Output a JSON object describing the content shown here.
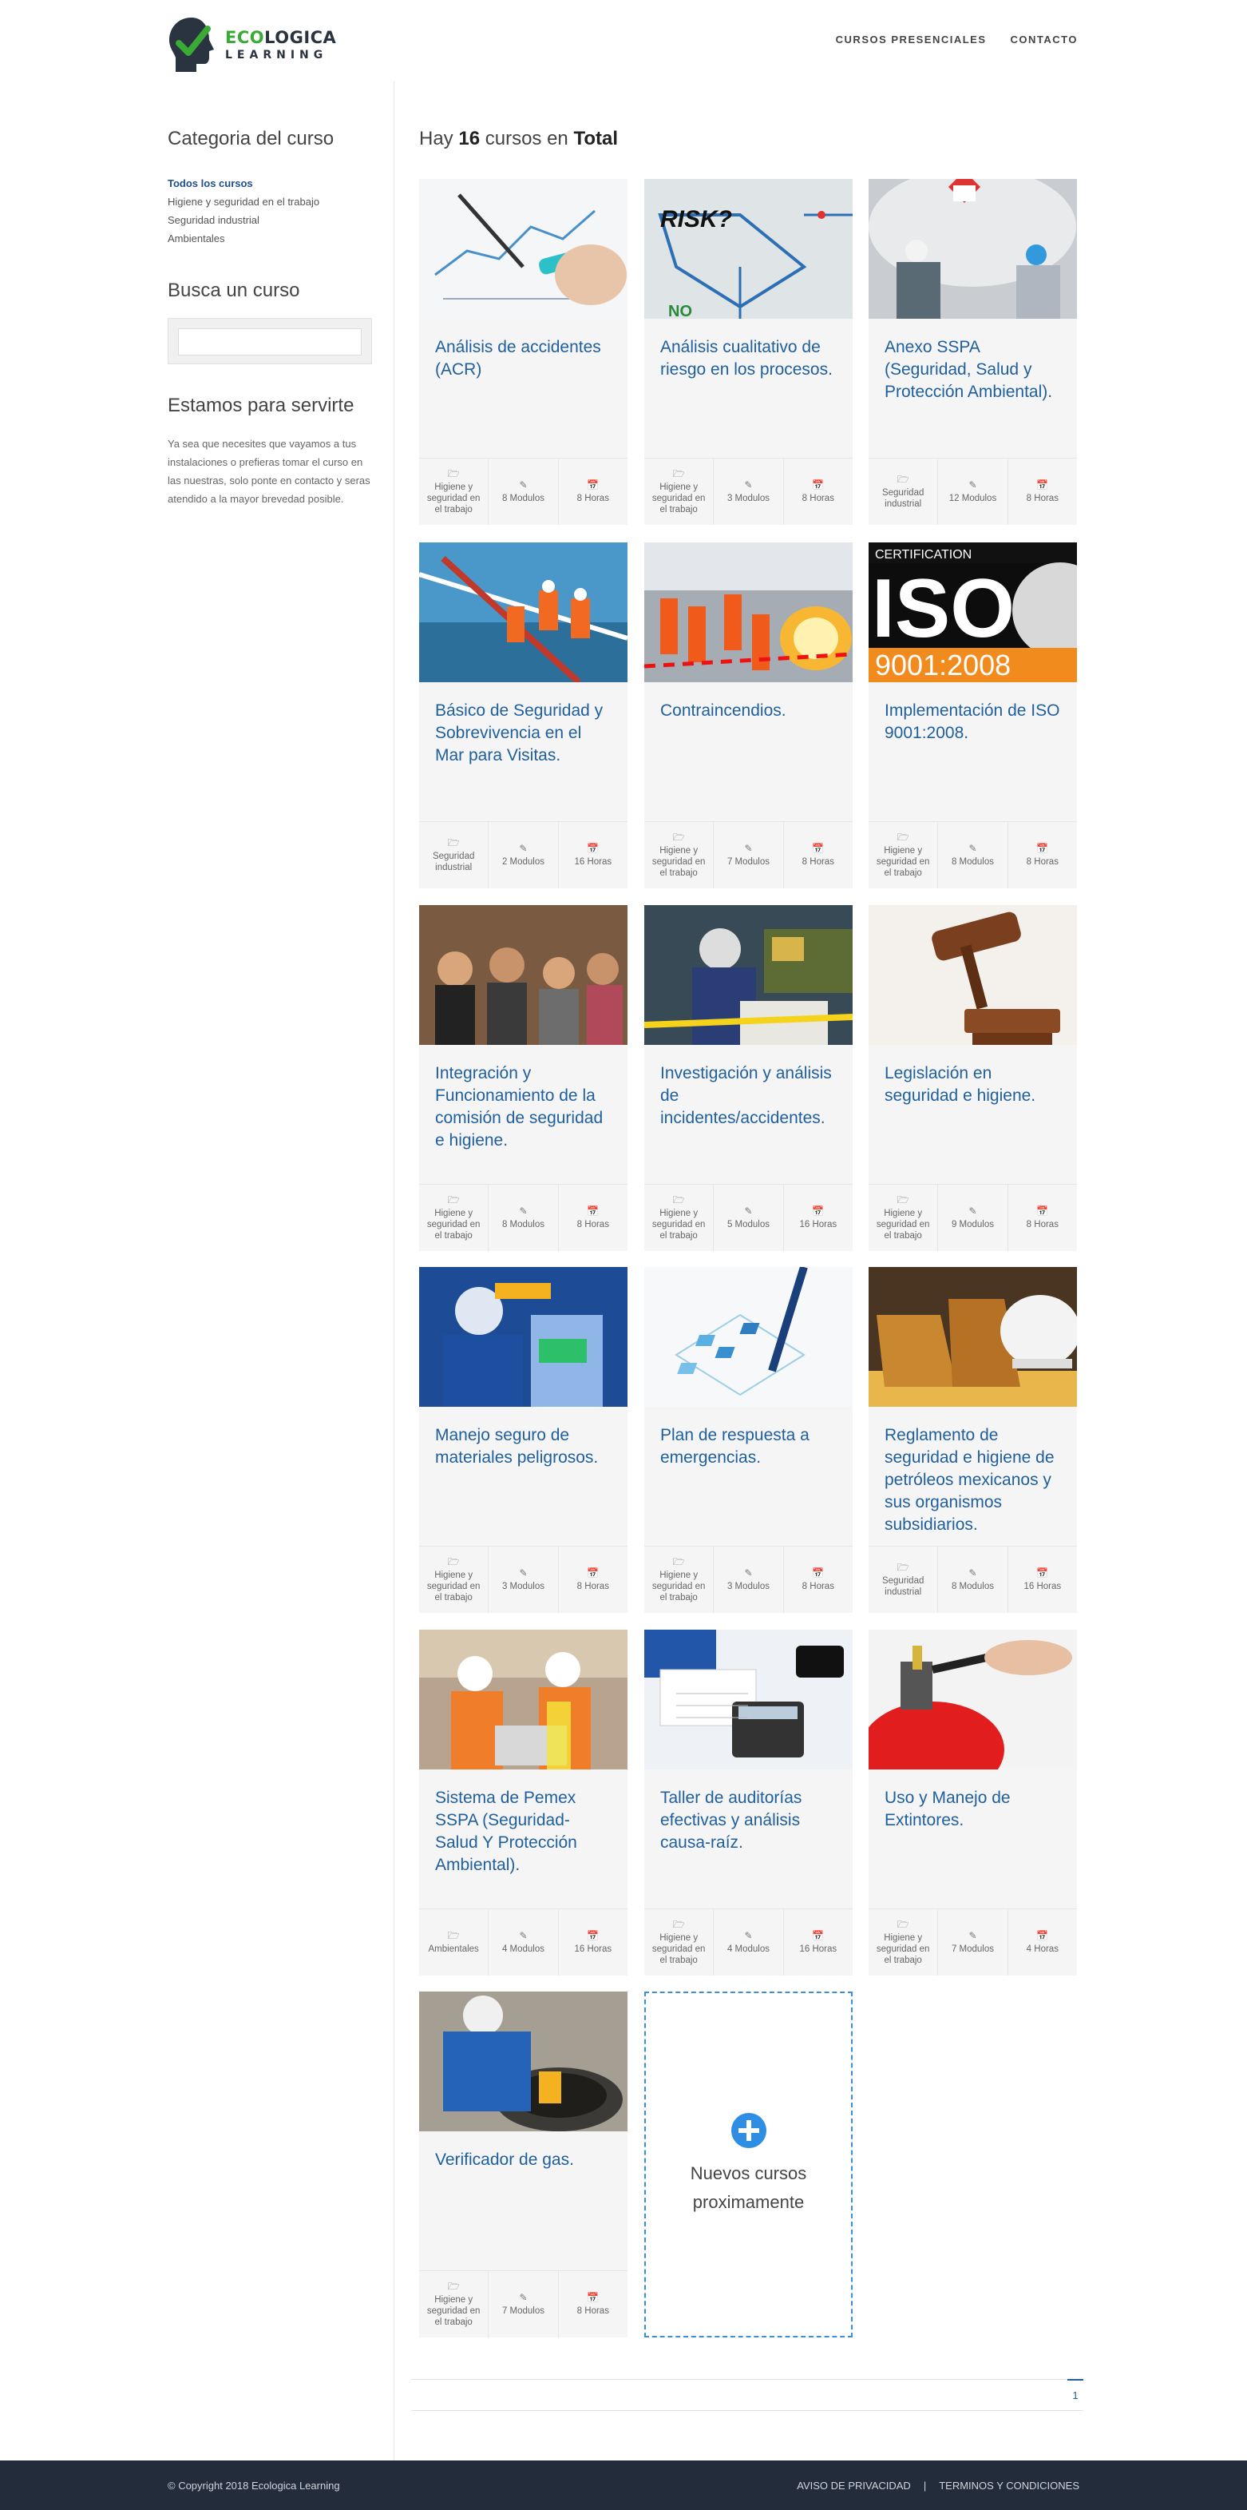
{
  "brand": {
    "line1_green": "ECO",
    "line1_dark": "LOGICA",
    "line2": "LEARNING"
  },
  "nav": [
    "CURSOS PRESENCIALES",
    "CONTACTO"
  ],
  "sidebar": {
    "categories_title": "Categoria del curso",
    "categories": [
      "Todos los cursos",
      "Higiene y seguridad en el trabajo",
      "Seguridad industrial",
      "Ambientales"
    ],
    "search_title": "Busca un curso",
    "search_placeholder": "",
    "service_title": "Estamos para servirte",
    "service_text": "Ya sea que necesites que vayamos a tus instalaciones o prefieras tomar el curso en las nuestras, solo ponte en contacto y seras atendido a la mayor brevedad posible."
  },
  "main": {
    "count_prefix": "Hay ",
    "count": "16",
    "count_mid": " cursos en ",
    "count_suffix": "Total"
  },
  "courses": [
    {
      "title": "Análisis de accidentes (ACR)",
      "category": "Higiene y seguridad en el trabajo",
      "modules": "8 Modulos",
      "hours": "8 Horas",
      "img": "chart"
    },
    {
      "title": "Análisis cualitativo de riesgo en los procesos.",
      "category": "Higiene y seguridad en el trabajo",
      "modules": "3 Modulos",
      "hours": "8 Horas",
      "img": "risk"
    },
    {
      "title": "Anexo SSPA (Seguridad, Salud y Protección Ambiental).",
      "category": "Seguridad industrial",
      "modules": "12 Modulos",
      "hours": "8 Horas",
      "img": "tank"
    },
    {
      "title": "Básico de Seguridad y Sobrevivencia en el Mar para Visitas.",
      "category": "Seguridad industrial",
      "modules": "2 Modulos",
      "hours": "16 Horas",
      "img": "sea"
    },
    {
      "title": "Contraincendios.",
      "category": "Higiene y seguridad en el trabajo",
      "modules": "7 Modulos",
      "hours": "8 Horas",
      "img": "fire"
    },
    {
      "title": "Implementación de ISO 9001:2008.",
      "category": "Higiene y seguridad en el trabajo",
      "modules": "8 Modulos",
      "hours": "8 Horas",
      "img": "iso"
    },
    {
      "title": "Integración y Funcionamiento de la comisión de seguridad e higiene.",
      "category": "Higiene y seguridad en el trabajo",
      "modules": "8 Modulos",
      "hours": "8 Horas",
      "img": "audience"
    },
    {
      "title": "Investigación y análisis de incidentes/accidentes.",
      "category": "Higiene y seguridad en el trabajo",
      "modules": "5 Modulos",
      "hours": "16 Horas",
      "img": "worker"
    },
    {
      "title": "Legislación en seguridad e higiene.",
      "category": "Higiene y seguridad en el trabajo",
      "modules": "9 Modulos",
      "hours": "8 Horas",
      "img": "gavel"
    },
    {
      "title": "Manejo seguro de materiales peligrosos.",
      "category": "Higiene y seguridad en el trabajo",
      "modules": "3 Modulos",
      "hours": "8 Horas",
      "img": "lab"
    },
    {
      "title": "Plan de respuesta a emergencias.",
      "category": "Higiene y seguridad en el trabajo",
      "modules": "3 Modulos",
      "hours": "8 Horas",
      "img": "plan"
    },
    {
      "title": "Reglamento de seguridad e higiene de petróleos mexicanos y sus organismos subsidiarios.",
      "category": "Seguridad industrial",
      "modules": "8 Modulos",
      "hours": "16 Horas",
      "img": "boots"
    },
    {
      "title": "Sistema de Pemex SSPA (Seguridad-Salud Y Protección Ambiental).",
      "category": "Ambientales",
      "modules": "4 Modulos",
      "hours": "16 Horas",
      "img": "engineers"
    },
    {
      "title": "Taller de auditorías efectivas y análisis causa-raíz.",
      "category": "Higiene y seguridad en el trabajo",
      "modules": "4 Modulos",
      "hours": "16 Horas",
      "img": "calc"
    },
    {
      "title": "Uso y Manejo de Extintores.",
      "category": "Higiene y seguridad en el trabajo",
      "modules": "7 Modulos",
      "hours": "4 Horas",
      "img": "extinguisher"
    },
    {
      "title": "Verificador de gas.",
      "category": "Higiene y seguridad en el trabajo",
      "modules": "7 Modulos",
      "hours": "8 Horas",
      "img": "gas"
    }
  ],
  "new_card": {
    "line1": "Nuevos cursos",
    "line2": "proximamente"
  },
  "iso_text": {
    "top": "CERTIFICATION",
    "big": "ISO",
    "num": "9001:2008"
  },
  "risk_text": {
    "word": "RISK?",
    "no": "NO"
  },
  "pagination": {
    "current": "1"
  },
  "footer": {
    "copyright": "© Copyright 2018 Ecologica Learning",
    "privacy": "AVISO DE PRIVACIDAD",
    "separator": "|",
    "terms": "TERMINOS Y CONDICIONES"
  },
  "colors": {
    "accent": "#1f5f9d",
    "footer_bg": "#232c3a",
    "brand_green": "#3aaa35",
    "new_border": "#3b8fd6"
  }
}
